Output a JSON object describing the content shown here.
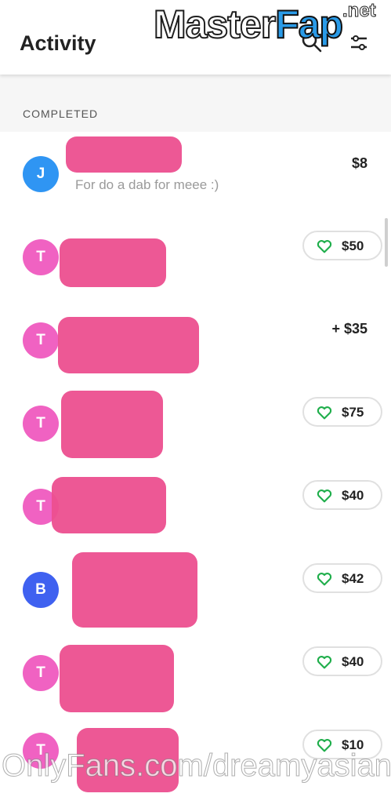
{
  "header": {
    "title": "Activity",
    "search_icon": "search-icon",
    "filter_icon": "filter-icon"
  },
  "section": {
    "label": "COMPLETED"
  },
  "rows": [
    {
      "avatar": "J",
      "avatar_color": "#2f95f3",
      "amount": "$8",
      "note": "For do a dab for meee :)",
      "liked": false
    },
    {
      "avatar": "T",
      "avatar_color": "#f062c2",
      "amount": "$50",
      "liked": true
    },
    {
      "avatar": "T",
      "avatar_color": "#f062c2",
      "amount": "+ $35",
      "liked": false
    },
    {
      "avatar": "T",
      "avatar_color": "#f062c2",
      "amount": "$75",
      "liked": true
    },
    {
      "avatar": "T",
      "avatar_color": "#f062c2",
      "amount": "$40",
      "liked": true
    },
    {
      "avatar": "B",
      "avatar_color": "#3f61f0",
      "amount": "$42",
      "liked": true
    },
    {
      "avatar": "T",
      "avatar_color": "#f062c2",
      "amount": "$40",
      "liked": true
    },
    {
      "avatar": "T",
      "avatar_color": "#f062c2",
      "amount": "$10",
      "liked": true
    }
  ],
  "colors": {
    "heart": "#1fae4b",
    "redaction": "#ec4f8f"
  },
  "watermarks": {
    "top_main": "Master",
    "top_accent": "Fap",
    "top_suffix": ".net",
    "bottom": "OnlyFans.com/dreamyasian"
  }
}
